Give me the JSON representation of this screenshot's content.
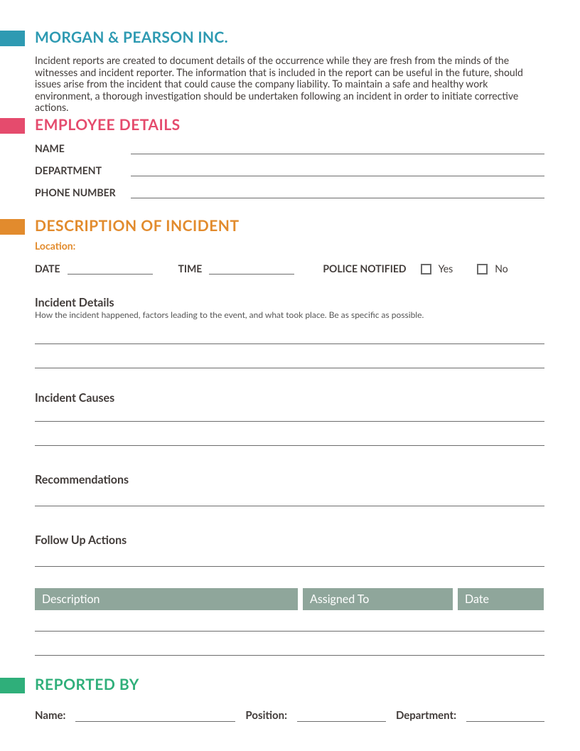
{
  "company": {
    "name": "MORGAN & PEARSON INC."
  },
  "intro": "Incident reports are created to document details of the occurrence while they are fresh from the minds of the witnesses and incident reporter. The information that is included in the report can be useful in the future, should issues arise from the incident that could cause the company liability. To maintain a safe and healthy work environment, a thorough investigation should be undertaken following an incident in order to initiate corrective actions.",
  "sections": {
    "employee": {
      "heading": "EMPLOYEE DETAILS",
      "fields": {
        "name": "NAME",
        "department": "DEPARTMENT",
        "phone": "PHONE NUMBER"
      }
    },
    "incident": {
      "heading": "DESCRIPTION OF INCIDENT",
      "location_label": "Location:",
      "date_label": "DATE",
      "time_label": "TIME",
      "police_label": "POLICE NOTIFIED",
      "yes": "Yes",
      "no": "No",
      "details_heading": "Incident Details",
      "details_note": "How the incident happened, factors leading to the event, and what took place. Be as specific as possible.",
      "causes_heading": "Incident Causes",
      "recommend_heading": "Recommendations",
      "followup_heading": "Follow Up Actions",
      "table": {
        "col1": "Description",
        "col2": "Assigned To",
        "col3": "Date"
      }
    },
    "reported": {
      "heading": "REPORTED BY",
      "name": "Name:",
      "position": "Position:",
      "department": "Department:"
    }
  }
}
